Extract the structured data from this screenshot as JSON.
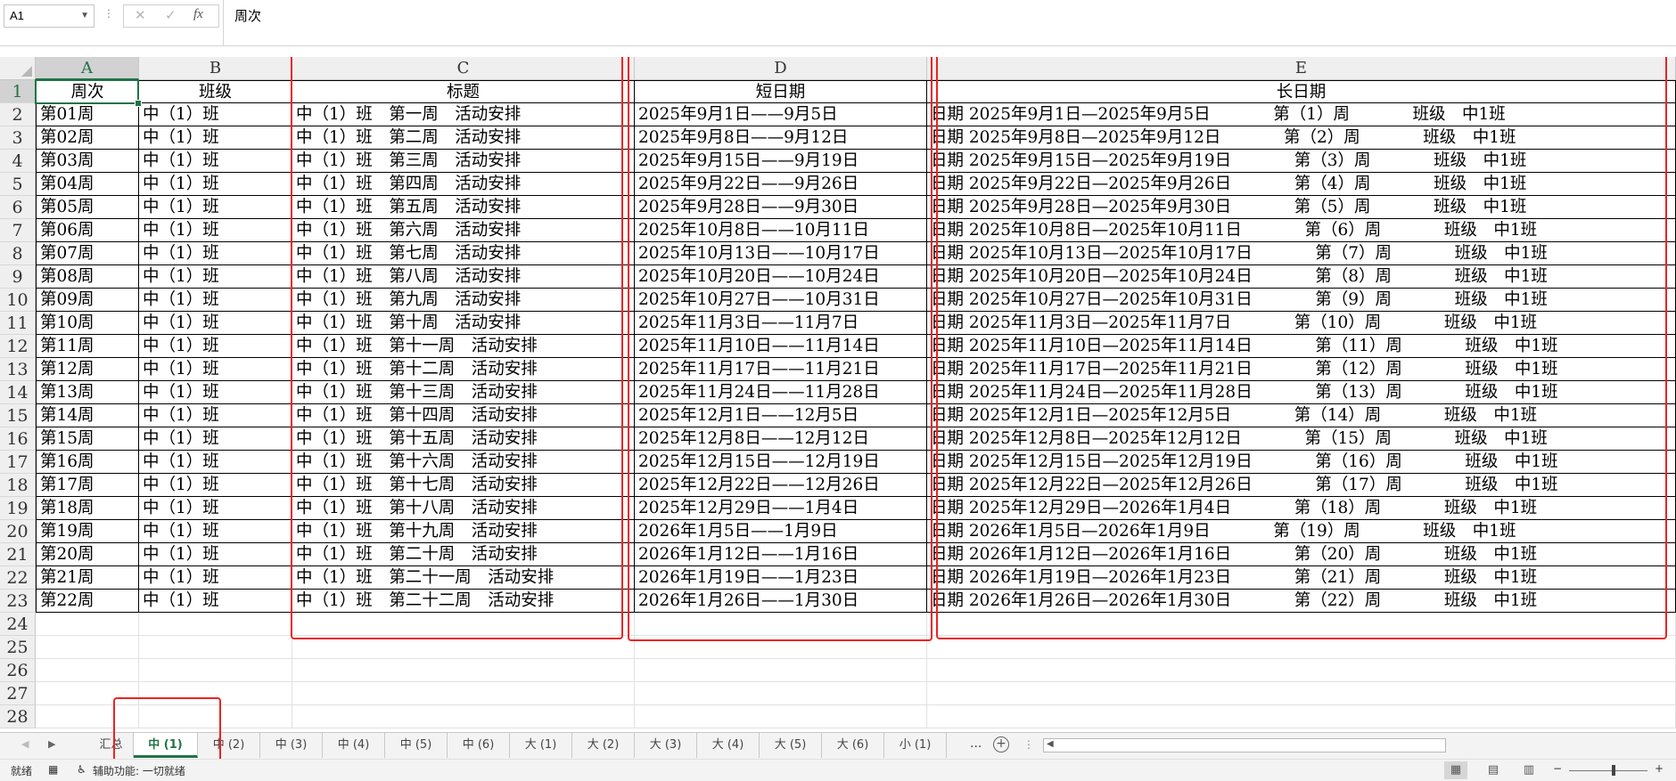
{
  "formula_bar": {
    "name_box": "A1",
    "cancel_icon": "✕",
    "enter_icon": "✓",
    "fx_label": "fx",
    "content": "周次"
  },
  "columns": [
    {
      "letter": "A",
      "key": "a"
    },
    {
      "letter": "B",
      "key": "b"
    },
    {
      "letter": "C",
      "key": "c"
    },
    {
      "letter": "D",
      "key": "d"
    },
    {
      "letter": "E",
      "key": "e"
    }
  ],
  "header_row": {
    "a": "周次",
    "b": "班级",
    "c": "标题",
    "d": "短日期",
    "e": "长日期"
  },
  "rows": [
    {
      "a": "第01周",
      "b": "中（1）班",
      "c": "中（1）班　第一周　活动安排",
      "d": "2025年9月1日——9月5日",
      "e": "日期 2025年9月1日—2025年9月5日            第（1）周            班级　中1班"
    },
    {
      "a": "第02周",
      "b": "中（1）班",
      "c": "中（1）班　第二周　活动安排",
      "d": "2025年9月8日——9月12日",
      "e": "日期 2025年9月8日—2025年9月12日            第（2）周            班级　中1班"
    },
    {
      "a": "第03周",
      "b": "中（1）班",
      "c": "中（1）班　第三周　活动安排",
      "d": "2025年9月15日——9月19日",
      "e": "日期 2025年9月15日—2025年9月19日            第（3）周            班级　中1班"
    },
    {
      "a": "第04周",
      "b": "中（1）班",
      "c": "中（1）班　第四周　活动安排",
      "d": "2025年9月22日——9月26日",
      "e": "日期 2025年9月22日—2025年9月26日            第（4）周            班级　中1班"
    },
    {
      "a": "第05周",
      "b": "中（1）班",
      "c": "中（1）班　第五周　活动安排",
      "d": "2025年9月28日——9月30日",
      "e": "日期 2025年9月28日—2025年9月30日            第（5）周            班级　中1班"
    },
    {
      "a": "第06周",
      "b": "中（1）班",
      "c": "中（1）班　第六周　活动安排",
      "d": "2025年10月8日——10月11日",
      "e": "日期 2025年10月8日—2025年10月11日            第（6）周            班级　中1班"
    },
    {
      "a": "第07周",
      "b": "中（1）班",
      "c": "中（1）班　第七周　活动安排",
      "d": "2025年10月13日——10月17日",
      "e": "日期 2025年10月13日—2025年10月17日            第（7）周            班级　中1班"
    },
    {
      "a": "第08周",
      "b": "中（1）班",
      "c": "中（1）班　第八周　活动安排",
      "d": "2025年10月20日——10月24日",
      "e": "日期 2025年10月20日—2025年10月24日            第（8）周            班级　中1班"
    },
    {
      "a": "第09周",
      "b": "中（1）班",
      "c": "中（1）班　第九周　活动安排",
      "d": "2025年10月27日——10月31日",
      "e": "日期 2025年10月27日—2025年10月31日            第（9）周            班级　中1班"
    },
    {
      "a": "第10周",
      "b": "中（1）班",
      "c": "中（1）班　第十周　活动安排",
      "d": "2025年11月3日——11月7日",
      "e": "日期 2025年11月3日—2025年11月7日            第（10）周            班级　中1班"
    },
    {
      "a": "第11周",
      "b": "中（1）班",
      "c": "中（1）班　第十一周　活动安排",
      "d": "2025年11月10日——11月14日",
      "e": "日期 2025年11月10日—2025年11月14日            第（11）周            班级　中1班"
    },
    {
      "a": "第12周",
      "b": "中（1）班",
      "c": "中（1）班　第十二周　活动安排",
      "d": "2025年11月17日——11月21日",
      "e": "日期 2025年11月17日—2025年11月21日            第（12）周            班级　中1班"
    },
    {
      "a": "第13周",
      "b": "中（1）班",
      "c": "中（1）班　第十三周　活动安排",
      "d": "2025年11月24日——11月28日",
      "e": "日期 2025年11月24日—2025年11月28日            第（13）周            班级　中1班"
    },
    {
      "a": "第14周",
      "b": "中（1）班",
      "c": "中（1）班　第十四周　活动安排",
      "d": "2025年12月1日——12月5日",
      "e": "日期 2025年12月1日—2025年12月5日            第（14）周            班级　中1班"
    },
    {
      "a": "第15周",
      "b": "中（1）班",
      "c": "中（1）班　第十五周　活动安排",
      "d": "2025年12月8日——12月12日",
      "e": "日期 2025年12月8日—2025年12月12日            第（15）周            班级　中1班"
    },
    {
      "a": "第16周",
      "b": "中（1）班",
      "c": "中（1）班　第十六周　活动安排",
      "d": "2025年12月15日——12月19日",
      "e": "日期 2025年12月15日—2025年12月19日            第（16）周            班级　中1班"
    },
    {
      "a": "第17周",
      "b": "中（1）班",
      "c": "中（1）班　第十七周　活动安排",
      "d": "2025年12月22日——12月26日",
      "e": "日期 2025年12月22日—2025年12月26日            第（17）周            班级　中1班"
    },
    {
      "a": "第18周",
      "b": "中（1）班",
      "c": "中（1）班　第十八周　活动安排",
      "d": "2025年12月29日——1月4日",
      "e": "日期 2025年12月29日—2026年1月4日            第（18）周            班级　中1班"
    },
    {
      "a": "第19周",
      "b": "中（1）班",
      "c": "中（1）班　第十九周　活动安排",
      "d": "2026年1月5日——1月9日",
      "e": "日期 2026年1月5日—2026年1月9日            第（19）周            班级　中1班"
    },
    {
      "a": "第20周",
      "b": "中（1）班",
      "c": "中（1）班　第二十周　活动安排",
      "d": "2026年1月12日——1月16日",
      "e": "日期 2026年1月12日—2026年1月16日            第（20）周            班级　中1班"
    },
    {
      "a": "第21周",
      "b": "中（1）班",
      "c": "中（1）班　第二十一周　活动安排",
      "d": "2026年1月19日——1月23日",
      "e": "日期 2026年1月19日—2026年1月23日            第（21）周            班级　中1班"
    },
    {
      "a": "第22周",
      "b": "中（1）班",
      "c": "中（1）班　第二十二周　活动安排",
      "d": "2026年1月26日——1月30日",
      "e": "日期 2026年1月26日—2026年1月30日            第（22）周            班级　中1班"
    }
  ],
  "empty_rows": [
    "24",
    "25",
    "26",
    "27",
    "28"
  ],
  "sheet_tabs": [
    "汇总",
    "中 (1)",
    "中 (2)",
    "中 (3)",
    "中 (4)",
    "中 (5)",
    "中 (6)",
    "大 (1)",
    "大 (2)",
    "大 (3)",
    "大 (4)",
    "大 (5)",
    "大 (6)",
    "小 (1)"
  ],
  "active_tab_index": 1,
  "tab_bar": {
    "more": "...",
    "add": "+"
  },
  "status_bar": {
    "ready": "就绪",
    "accessibility": "辅助功能: 一切就绪",
    "zoom_minus": "−",
    "zoom_plus": "+"
  },
  "colors": {
    "accent": "#217346",
    "highlight": "#ee2222"
  }
}
